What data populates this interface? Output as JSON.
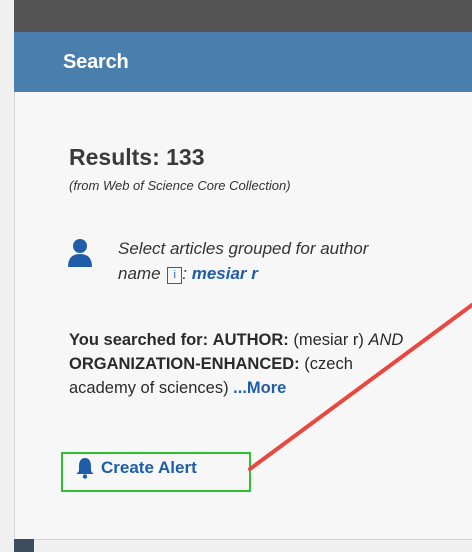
{
  "header": {
    "title": "Search"
  },
  "results": {
    "title": "Results: 133",
    "subtitle": "(from Web of Science Core Collection)"
  },
  "author": {
    "prefix": "Select articles grouped for author name",
    "info_icon_glyph": "i",
    "link": "mesiar r",
    "icon": "person-icon"
  },
  "query": {
    "lead": "You searched for:",
    "field1": "AUTHOR:",
    "value1": "(mesiar r)",
    "operator": "AND",
    "field2": "ORGANIZATION-ENHANCED:",
    "value2": "(czech academy of sciences)",
    "more_label": "...More"
  },
  "alert": {
    "label": "Create Alert",
    "icon": "bell-icon"
  },
  "colors": {
    "header": "#4a7eac",
    "link": "#1f5da8",
    "highlight_box": "#2ec02e",
    "arrow": "#e8483f"
  }
}
